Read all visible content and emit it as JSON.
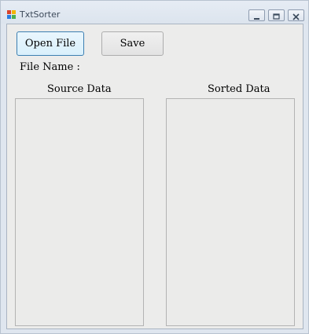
{
  "window": {
    "title": "TxtSorter",
    "icon": "app-icon",
    "controls": [
      "minimize-icon",
      "maximize-icon",
      "close-icon"
    ]
  },
  "toolbar": {
    "open_label": "Open File",
    "save_label": "Save"
  },
  "file": {
    "label": "File Name :"
  },
  "panels": {
    "source_title": "Source Data",
    "sorted_title": "Sorted Data"
  },
  "colors": {
    "accent_border": "#3c7fb1",
    "client_bg": "#ececeb"
  }
}
